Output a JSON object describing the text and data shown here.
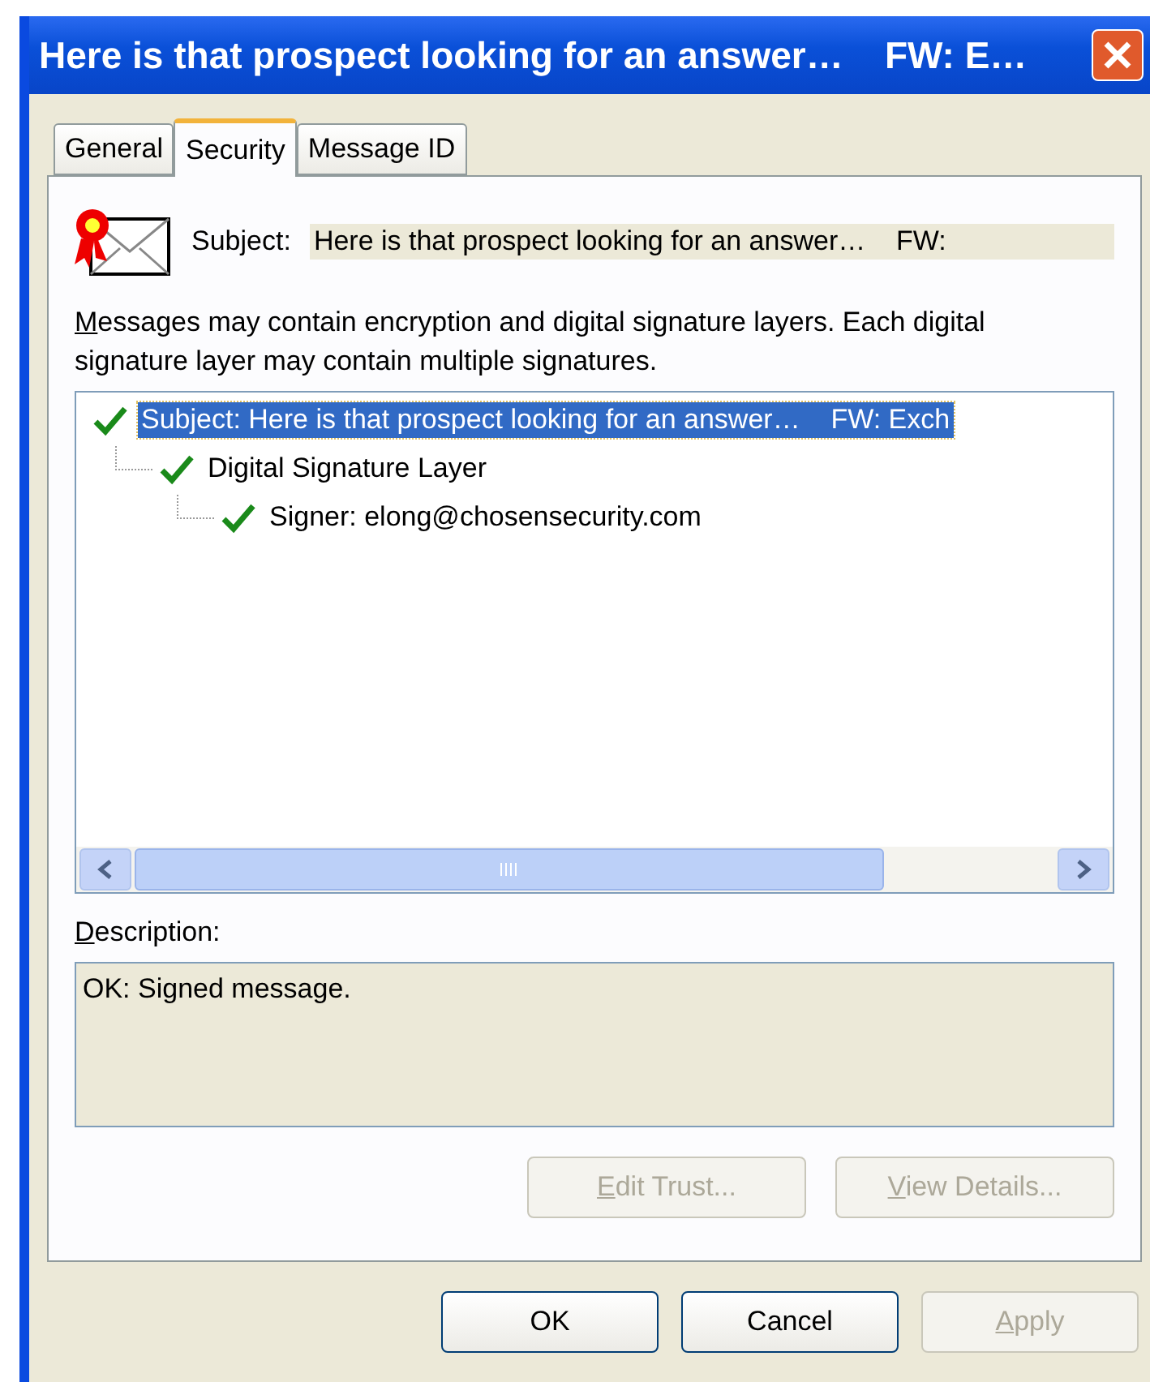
{
  "window": {
    "title": "Here is that prospect looking for an answer…    FW: E…"
  },
  "tabs": [
    {
      "label": "General",
      "selected": false
    },
    {
      "label": "Security",
      "selected": true
    },
    {
      "label": "Message ID",
      "selected": false
    }
  ],
  "subject": {
    "label": "Subject:",
    "value": "Here is that prospect looking for an answer…    FW:"
  },
  "intro": "Messages may contain encryption and digital signature layers.  Each digital signature layer may contain multiple signatures.",
  "tree": [
    {
      "label": "Subject: Here is that prospect looking for an answer…    FW: Exch",
      "selected": true,
      "children": [
        {
          "label": "Digital Signature Layer",
          "selected": false,
          "children": [
            {
              "label": "Signer: elong@chosensecurity.com",
              "selected": false
            }
          ]
        }
      ]
    }
  ],
  "description": {
    "label": "Description:",
    "text": "OK: Signed message."
  },
  "panel_buttons": [
    {
      "label": "Edit Trust...",
      "disabled": true
    },
    {
      "label": "View Details...",
      "disabled": true
    }
  ],
  "dialog_buttons": [
    {
      "label": "OK",
      "disabled": false
    },
    {
      "label": "Cancel",
      "disabled": false
    },
    {
      "label": "Apply",
      "disabled": true
    }
  ]
}
